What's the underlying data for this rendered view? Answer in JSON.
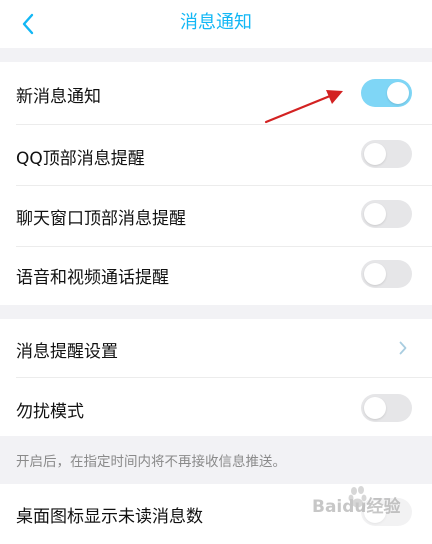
{
  "header": {
    "title": "消息通知",
    "back_icon": "chevron-left-icon"
  },
  "colors": {
    "accent": "#12b7f5",
    "toggle_on": "#7fd6f6",
    "toggle_off": "#e6e6e8",
    "annotation_arrow": "#d32222"
  },
  "group1": {
    "items": [
      {
        "label": "新消息通知",
        "toggle": "on"
      },
      {
        "label": "QQ顶部消息提醒",
        "toggle": "off"
      },
      {
        "label": "聊天窗口顶部消息提醒",
        "toggle": "off"
      },
      {
        "label": "语音和视频通话提醒",
        "toggle": "off"
      }
    ]
  },
  "group2": {
    "items": [
      {
        "label": "消息提醒设置",
        "control": "chevron-right-icon"
      },
      {
        "label": "勿扰模式",
        "toggle": "off"
      }
    ],
    "hint": "开启后，在指定时间内将不再接收信息推送。"
  },
  "group3": {
    "items": [
      {
        "label": "桌面图标显示未读消息数"
      }
    ]
  },
  "watermark": {
    "text": "Baidu经验"
  }
}
